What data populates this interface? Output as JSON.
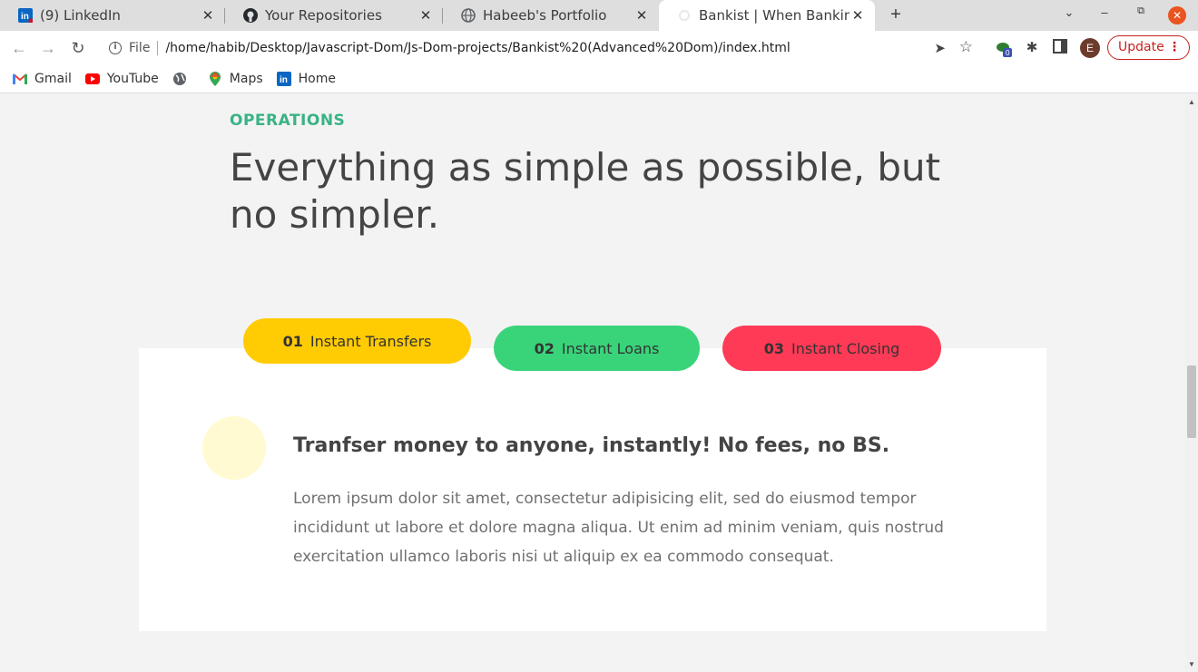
{
  "browser": {
    "tabs": [
      {
        "title": "(9) LinkedIn",
        "icon": "linkedin-icon"
      },
      {
        "title": "Your Repositories",
        "icon": "github-icon"
      },
      {
        "title": "Habeeb's Portfolio",
        "icon": "globe-icon"
      },
      {
        "title": "Bankist | When Banking m",
        "icon": "bankist-icon",
        "active": true
      }
    ],
    "close_glyph": "✕",
    "url_scheme": "File",
    "url": "/home/habib/Desktop/Javascript-Dom/Js-Dom-projects/Bankist%20(Advanced%20Dom)/index.html",
    "avatar_letter": "E",
    "extension_badge": "0",
    "update_label": "Update",
    "bookmarks": [
      {
        "label": "Gmail",
        "icon": "gmail-icon"
      },
      {
        "label": "YouTube",
        "icon": "youtube-icon"
      },
      {
        "label": "",
        "icon": "globe-icon"
      },
      {
        "label": "Maps",
        "icon": "maps-icon"
      },
      {
        "label": "Home",
        "icon": "linkedin-icon"
      }
    ]
  },
  "page": {
    "section_label": "OPERATIONS",
    "section_heading": "Everything as simple as possible, but no simpler.",
    "tabs": [
      {
        "num": "01",
        "label": "Instant Transfers",
        "color": "#ffcb03"
      },
      {
        "num": "02",
        "label": "Instant Loans",
        "color": "#39d47a"
      },
      {
        "num": "03",
        "label": "Instant Closing",
        "color": "#ff3a56"
      }
    ],
    "content": {
      "title": "Tranfser money to anyone, instantly! No fees, no BS.",
      "text": "Lorem ipsum dolor sit amet, consectetur adipisicing elit, sed do eiusmod tempor incididunt ut labore et dolore magna aliqua. Ut enim ad minim veniam, quis nostrud exercitation ullamco laboris nisi ut aliquip ex ea commodo consequat."
    },
    "accent_color": "#39b385"
  }
}
